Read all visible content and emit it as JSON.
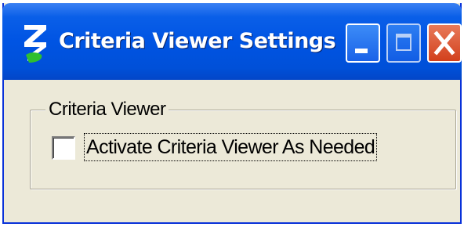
{
  "window": {
    "title": "Criteria Viewer Settings",
    "app_icon": "bentley-b-icon",
    "titlebar_color": "#0054e3",
    "body_color": "#ece9d8",
    "controls": {
      "minimize": "minimize-icon",
      "maximize": "maximize-icon",
      "close": "close-icon"
    }
  },
  "group": {
    "legend": "Criteria Viewer",
    "checkbox_label": "Activate Criteria Viewer As Needed",
    "checked": false
  }
}
